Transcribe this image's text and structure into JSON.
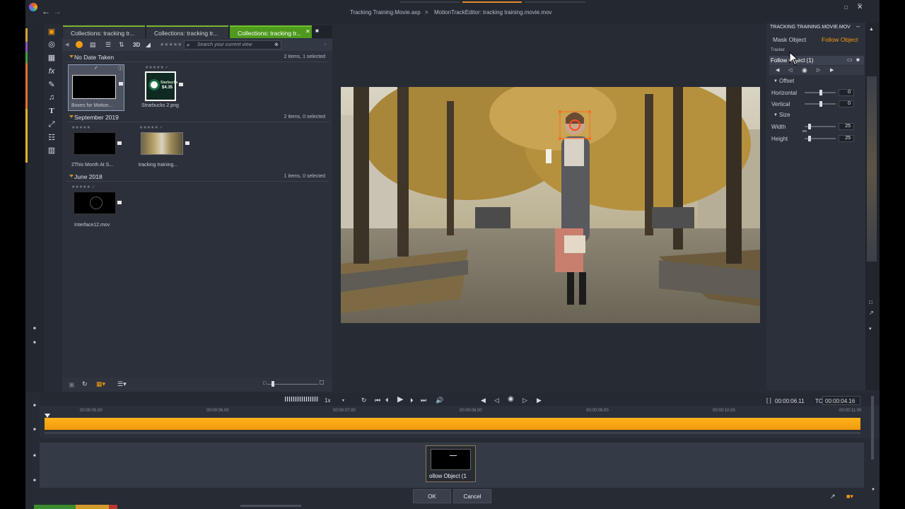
{
  "titlebar": {
    "project": "Tracking Training.Movie.axp",
    "separator": ">",
    "editor": "MotionTrackEditor: tracking training.movie.mov"
  },
  "library": {
    "tabs": [
      {
        "label": "Collections: tracking tr...",
        "active": false
      },
      {
        "label": "Collections: tracking tr...",
        "active": false
      },
      {
        "label": "Collections: tracking tr...",
        "active": true
      }
    ],
    "search_placeholder": "Search your current view",
    "toolbar_3d": "3D",
    "groups": [
      {
        "title": "No Date Taken",
        "count": "2 items, 1 selected",
        "items": [
          {
            "caption": "Boxes for Motion...",
            "selected": true
          },
          {
            "caption": "Strarbucks 2.png",
            "selected": false
          }
        ]
      },
      {
        "title": "September 2019",
        "count": "2 items, 0 selected",
        "items": [
          {
            "caption": "2This Month At S..."
          },
          {
            "caption": "tracking training..."
          }
        ]
      },
      {
        "title": "June 2018",
        "count": "1 items, 0 selected",
        "items": [
          {
            "caption": "Interface12.mov"
          }
        ]
      }
    ],
    "starbucks_text_1": "Starbucks",
    "starbucks_text_2": "$4.35"
  },
  "right_panel": {
    "file_title": "TRACKING TRAINING.MOVIE.MOV",
    "tabs": [
      "Mask Object",
      "Follow Object"
    ],
    "active_tab": "Follow Object",
    "section": "Tracker",
    "object_name": "Follow Object (1)",
    "offset_label": "Offset",
    "horizontal_label": "Horizontal",
    "horizontal_value": "0",
    "vertical_label": "Vertical",
    "vertical_value": "0",
    "size_label": "Size",
    "width_label": "Width",
    "width_value": "25",
    "height_label": "Height",
    "height_value": "25"
  },
  "timeline": {
    "speed": "1x",
    "timecode_in": "00:00:06.11",
    "tc_label": "TC",
    "timecode": "00:00:04.16",
    "ruler": [
      "00:00:05.00",
      "00:00:06.00",
      "00:00:07.00",
      "00:00:08.00",
      "00:00:09.00",
      "00:00:10.00",
      "00:00:11.00"
    ],
    "keyframe_label": "ollow Object (1"
  },
  "buttons": {
    "ok": "OK",
    "cancel": "Cancel"
  },
  "colors": {
    "accent": "#f39c12",
    "tab_active": "#4f9a1e",
    "track_bar": "#ffb31a"
  }
}
